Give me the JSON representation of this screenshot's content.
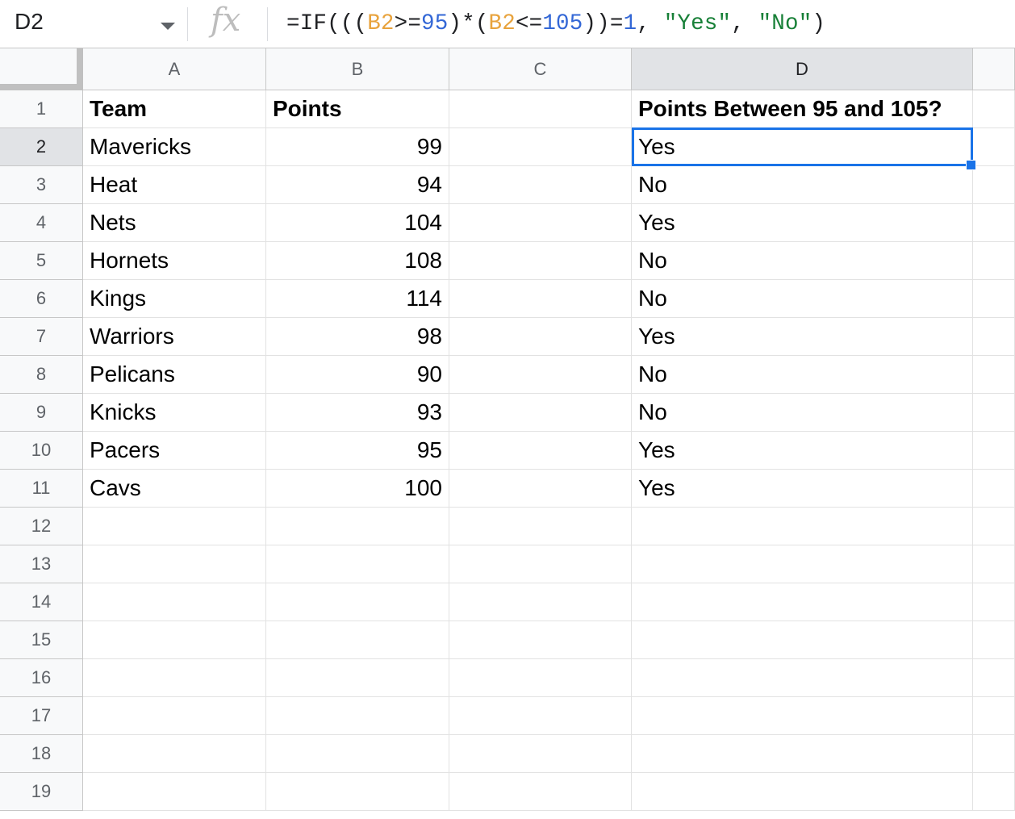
{
  "name_box": {
    "value": "D2"
  },
  "fx_icon": "fx",
  "formula_bar": {
    "tokens": [
      {
        "text": "=IF(((",
        "kind": "plain"
      },
      {
        "text": "B2",
        "kind": "ref"
      },
      {
        "text": ">=",
        "kind": "plain"
      },
      {
        "text": "95",
        "kind": "num"
      },
      {
        "text": ")*(",
        "kind": "plain"
      },
      {
        "text": "B2",
        "kind": "ref"
      },
      {
        "text": "<=",
        "kind": "plain"
      },
      {
        "text": "105",
        "kind": "num"
      },
      {
        "text": "))=",
        "kind": "plain"
      },
      {
        "text": "1",
        "kind": "num"
      },
      {
        "text": ", ",
        "kind": "plain"
      },
      {
        "text": "\"Yes\"",
        "kind": "str"
      },
      {
        "text": ", ",
        "kind": "plain"
      },
      {
        "text": "\"No\"",
        "kind": "str"
      },
      {
        "text": ")",
        "kind": "plain"
      }
    ]
  },
  "columns": [
    "A",
    "B",
    "C",
    "D"
  ],
  "selected_column": "D",
  "selected_row": 2,
  "rows": [
    {
      "num": "1",
      "a": "Team",
      "b": "Points",
      "c": "",
      "d": "Points Between 95 and 105?",
      "header": true
    },
    {
      "num": "2",
      "a": "Mavericks",
      "b": "99",
      "c": "",
      "d": "Yes"
    },
    {
      "num": "3",
      "a": "Heat",
      "b": "94",
      "c": "",
      "d": "No"
    },
    {
      "num": "4",
      "a": "Nets",
      "b": "104",
      "c": "",
      "d": "Yes"
    },
    {
      "num": "5",
      "a": "Hornets",
      "b": "108",
      "c": "",
      "d": "No"
    },
    {
      "num": "6",
      "a": "Kings",
      "b": "114",
      "c": "",
      "d": "No"
    },
    {
      "num": "7",
      "a": "Warriors",
      "b": "98",
      "c": "",
      "d": "Yes"
    },
    {
      "num": "8",
      "a": "Pelicans",
      "b": "90",
      "c": "",
      "d": "No"
    },
    {
      "num": "9",
      "a": "Knicks",
      "b": "93",
      "c": "",
      "d": "No"
    },
    {
      "num": "10",
      "a": "Pacers",
      "b": "95",
      "c": "",
      "d": "Yes"
    },
    {
      "num": "11",
      "a": "Cavs",
      "b": "100",
      "c": "",
      "d": "Yes"
    },
    {
      "num": "12",
      "a": "",
      "b": "",
      "c": "",
      "d": ""
    },
    {
      "num": "13",
      "a": "",
      "b": "",
      "c": "",
      "d": ""
    },
    {
      "num": "14",
      "a": "",
      "b": "",
      "c": "",
      "d": ""
    },
    {
      "num": "15",
      "a": "",
      "b": "",
      "c": "",
      "d": ""
    },
    {
      "num": "16",
      "a": "",
      "b": "",
      "c": "",
      "d": ""
    },
    {
      "num": "17",
      "a": "",
      "b": "",
      "c": "",
      "d": ""
    },
    {
      "num": "18",
      "a": "",
      "b": "",
      "c": "",
      "d": ""
    },
    {
      "num": "19",
      "a": "",
      "b": "",
      "c": "",
      "d": ""
    }
  ],
  "colors": {
    "selection": "#1a73e8",
    "ref": "#e8a33d",
    "number": "#3367d6",
    "string": "#188038"
  }
}
